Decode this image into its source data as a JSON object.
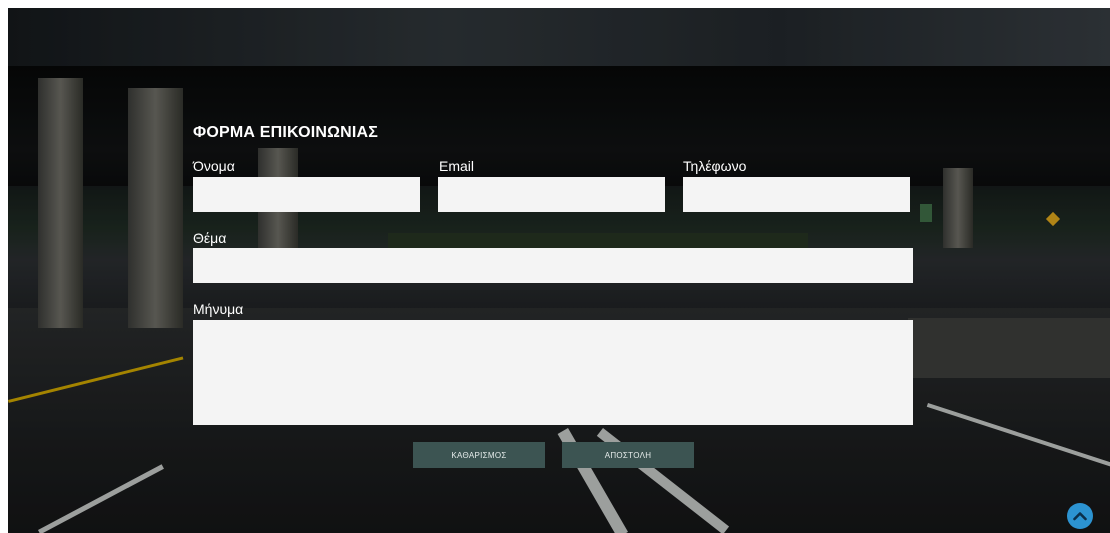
{
  "form": {
    "title": "ΦΟΡΜΑ ΕΠΙΚΟΙΝΩΝΙΑΣ",
    "fields": {
      "name": {
        "label": "Όνομα",
        "value": ""
      },
      "email": {
        "label": "Email",
        "value": ""
      },
      "phone": {
        "label": "Τηλέφωνο",
        "value": ""
      },
      "subject": {
        "label": "Θέμα",
        "value": ""
      },
      "message": {
        "label": "Μήνυμα",
        "value": ""
      }
    },
    "buttons": {
      "clear": "ΚΑΘΑΡΙΣΜΟΣ",
      "submit": "ΑΠΟΣΤΟΛΗ"
    }
  },
  "icons": {
    "scroll_top": "chevron-up-icon"
  },
  "colors": {
    "button_bg": "#3c5452",
    "scroll_top_bg": "#2c93d1",
    "field_bg": "#f4f4f4"
  }
}
